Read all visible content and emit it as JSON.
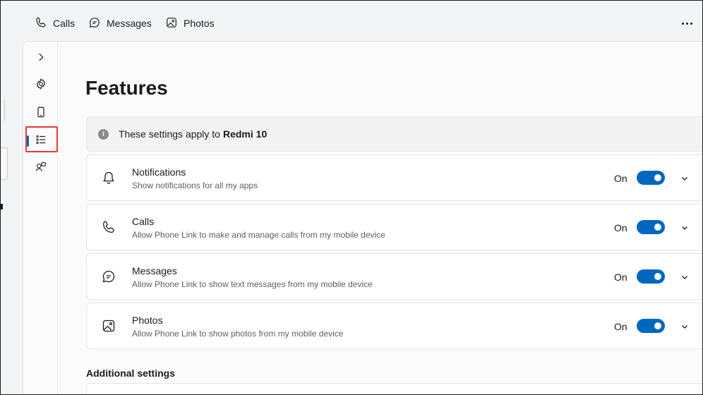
{
  "topbar": {
    "tabs": [
      {
        "label": "Calls",
        "icon": "phone-icon"
      },
      {
        "label": "Messages",
        "icon": "message-icon"
      },
      {
        "label": "Photos",
        "icon": "photo-icon"
      }
    ],
    "more_icon": "more-icon"
  },
  "sidenav": {
    "items": [
      {
        "icon": "chevron-right-icon"
      },
      {
        "icon": "gear-icon"
      },
      {
        "icon": "mobile-device-icon"
      },
      {
        "icon": "features-list-icon",
        "active": true
      },
      {
        "icon": "personalization-icon"
      }
    ]
  },
  "page": {
    "title": "Features",
    "info": {
      "prefix": "These settings apply to",
      "device": "Redmi 10",
      "icon": "info-icon"
    },
    "features": [
      {
        "title": "Notifications",
        "desc": "Show notifications for all my apps",
        "state": "On",
        "icon": "bell-icon"
      },
      {
        "title": "Calls",
        "desc": "Allow Phone Link to make and manage calls from my mobile device",
        "state": "On",
        "icon": "phone-icon"
      },
      {
        "title": "Messages",
        "desc": "Allow Phone Link to show text messages from my mobile device",
        "state": "On",
        "icon": "message-icon"
      },
      {
        "title": "Photos",
        "desc": "Allow Phone Link to show photos from my mobile device",
        "state": "On",
        "icon": "photo-icon"
      }
    ],
    "additional_title": "Additional settings"
  },
  "colors": {
    "accent": "#0067c0",
    "highlight": "#e53935"
  }
}
